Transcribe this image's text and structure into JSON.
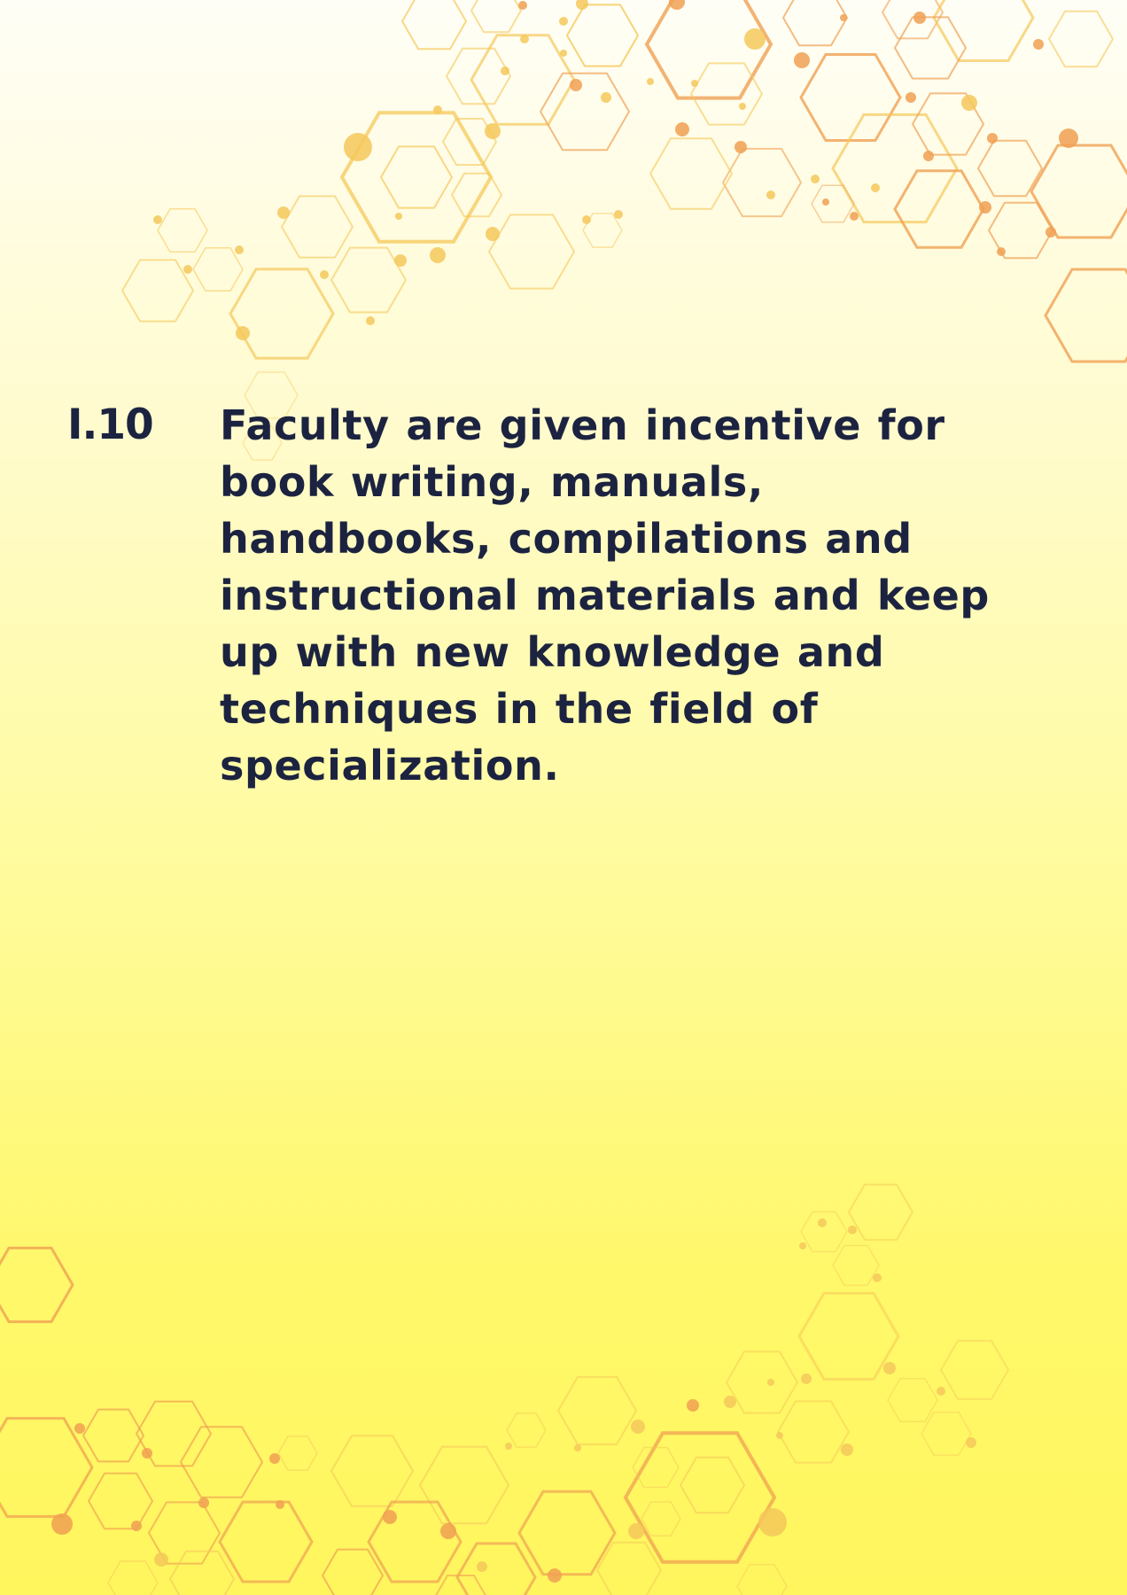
{
  "document": {
    "item_number": "I.10",
    "item_text": "Faculty are given incentive for book writing, manuals, handbooks, compilations and instructional materials and keep up with new knowledge and techniques in the field of specialization."
  },
  "colors": {
    "background_top": "#fffef6",
    "background_bottom": "#fff65e",
    "hexagon_gold": "#f5c85a",
    "hexagon_orange": "#f0a052",
    "text": "#1c2340"
  }
}
